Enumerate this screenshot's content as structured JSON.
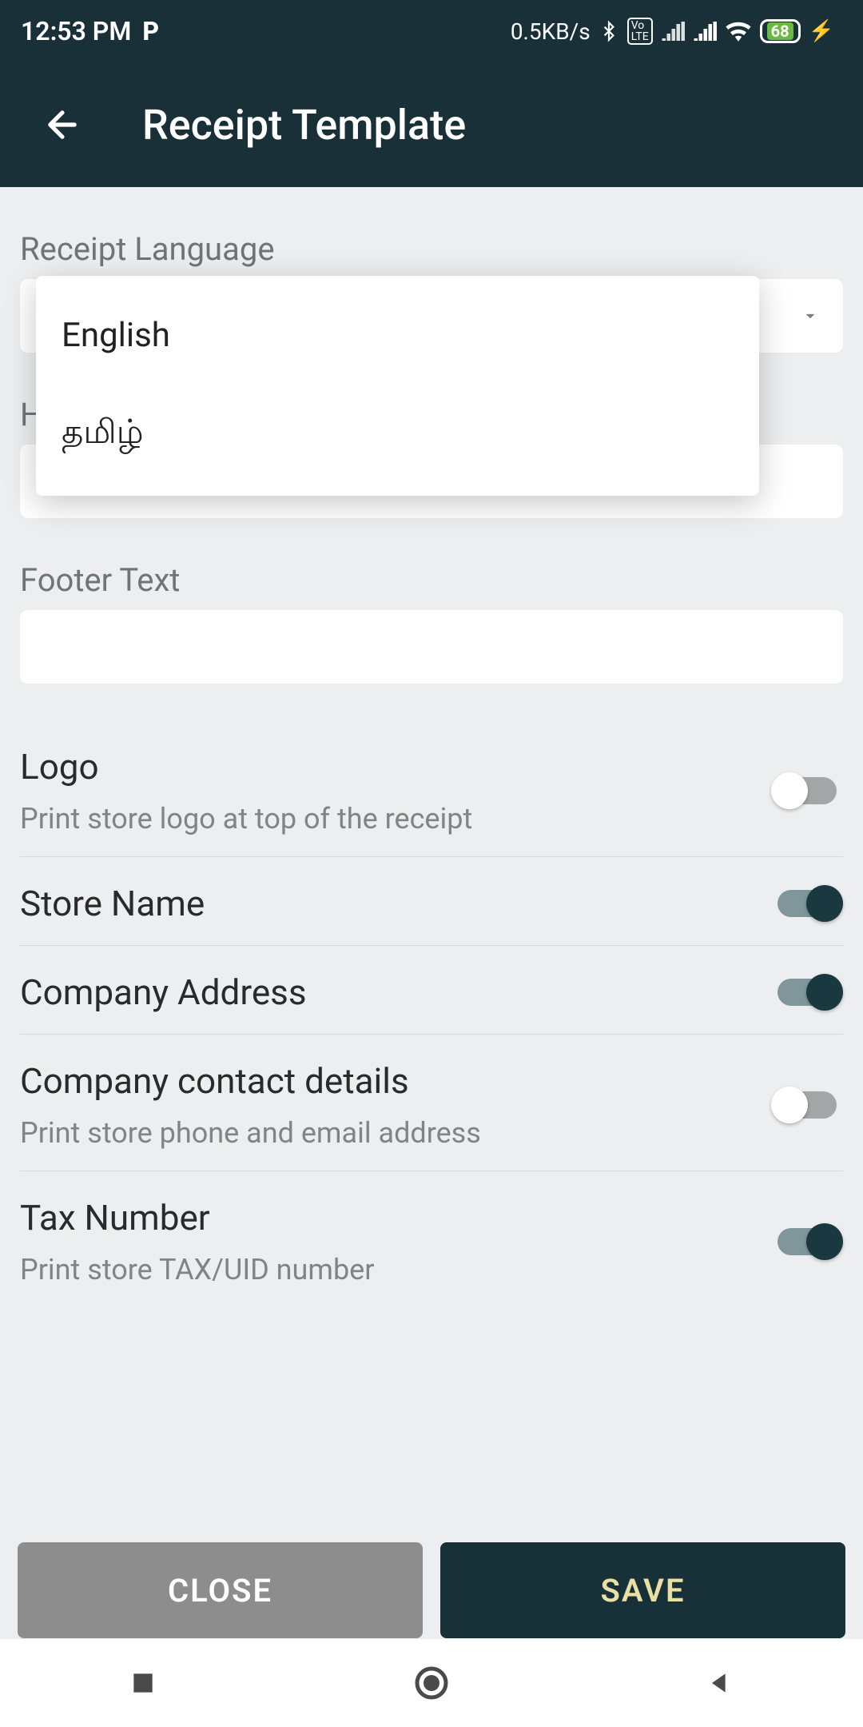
{
  "statusBar": {
    "time": "12:53 PM",
    "pIndicator": "P",
    "dataRate": "0.5KB/s",
    "batteryLevel": "68"
  },
  "appBar": {
    "title": "Receipt Template"
  },
  "labels": {
    "receiptLanguage": "Receipt Language",
    "headerPartial": "H",
    "footerText": "Footer Text"
  },
  "languageDropdown": {
    "selectedValue": "English",
    "options": [
      "English",
      "தமிழ்"
    ]
  },
  "settings": {
    "logo": {
      "title": "Logo",
      "desc": "Print store logo at top of the receipt",
      "enabled": false
    },
    "storeName": {
      "title": "Store Name",
      "enabled": true
    },
    "companyAddress": {
      "title": "Company Address",
      "enabled": true
    },
    "contactDetails": {
      "title": "Company contact details",
      "desc": "Print store phone and email address",
      "enabled": false
    },
    "taxNumber": {
      "title": "Tax Number",
      "desc": "Print store TAX/UID number",
      "enabled": true
    }
  },
  "buttons": {
    "close": "CLOSE",
    "save": "SAVE"
  }
}
